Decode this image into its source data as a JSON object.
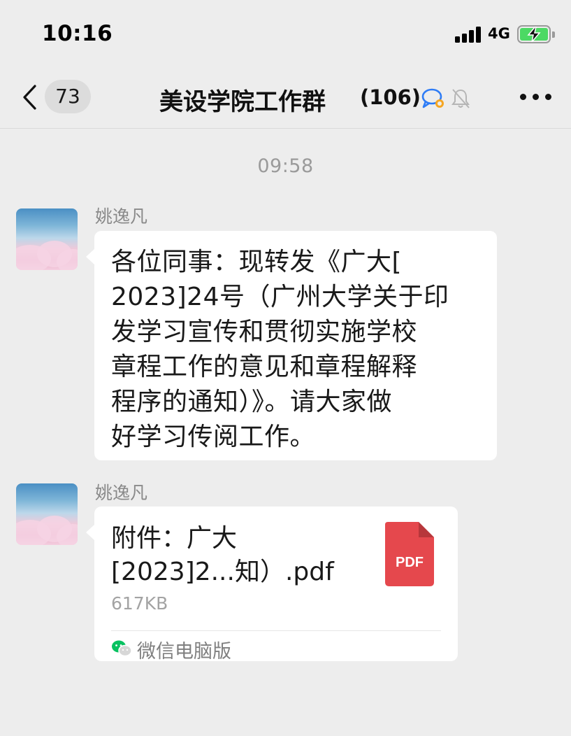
{
  "status_bar": {
    "time": "10:16",
    "network": "4G"
  },
  "nav": {
    "unread_count": "73",
    "title": "美设学院工作群",
    "member_count": "(106)"
  },
  "timestamp": "09:58",
  "messages": [
    {
      "sender": "姚逸凡",
      "lines": [
        "各位同事：现转发《广大[",
        "2023]24号（广州大学关于印",
        "发学习宣传和贯彻实施学校",
        "章程工作的意见和章程解释",
        "程序的通知）》。请大家做",
        "好学习传阅工作。"
      ]
    },
    {
      "sender": "姚逸凡",
      "file": {
        "name_line1": "附件：广大",
        "name_line2": "[2023]2...知）.pdf",
        "size": "617KB",
        "icon_label": "PDF",
        "source": "微信电脑版"
      }
    }
  ],
  "colors": {
    "background": "#ededed",
    "bubble": "#ffffff",
    "pdf_red": "#e5484d",
    "wechat_green": "#07c160",
    "battery_green": "#4cd964"
  }
}
